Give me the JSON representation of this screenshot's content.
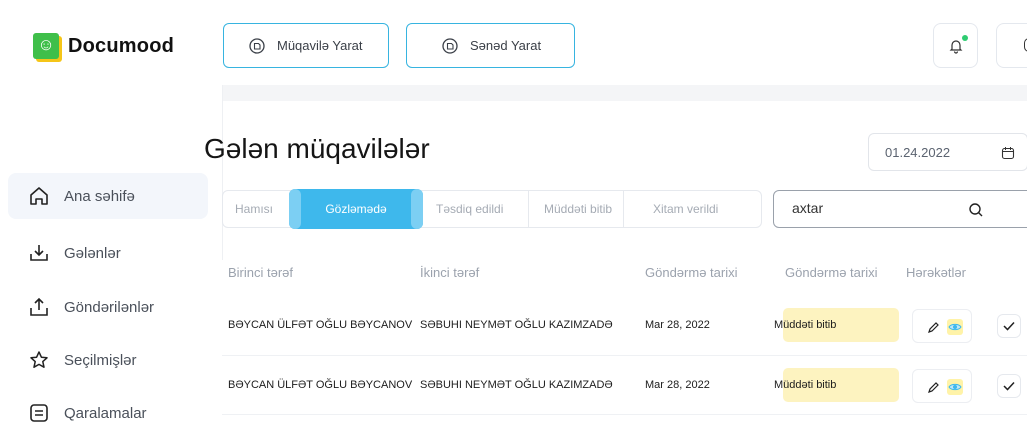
{
  "app": {
    "logo_text": "Documood",
    "logo_glyph": "☺"
  },
  "toolbar": {
    "create_contract": "Müqavilə Yarat",
    "create_document": "Sənəd Yarat"
  },
  "page": {
    "title": "Gələn müqavilələr",
    "date": "01.24.2022"
  },
  "sidebar": {
    "items": [
      {
        "label": "Ana səhifə",
        "icon": "home-icon"
      },
      {
        "label": "Gələnlər",
        "icon": "inbox-download-icon"
      },
      {
        "label": "Göndərilənlər",
        "icon": "upload-icon"
      },
      {
        "label": "Seçilmişlər",
        "icon": "star-icon"
      },
      {
        "label": "Qaralamalar",
        "icon": "drafts-icon"
      }
    ]
  },
  "tabs": [
    {
      "label": "Hamısı"
    },
    {
      "label": "Gözləmədə"
    },
    {
      "label": "Təsdiq edildi"
    },
    {
      "label": "Müddəti bitib"
    },
    {
      "label": "Xitam verildi"
    }
  ],
  "search": {
    "placeholder": "axtar"
  },
  "table": {
    "headers": [
      "Birinci tərəf",
      "İkinci tərəf",
      "Göndərmə tarixi",
      "Göndərmə tarixi",
      "Hərəkətlər"
    ],
    "rows": [
      {
        "first": "BƏYCAN ÜLFƏT OĞLU BƏYCANOV",
        "second": "SƏBUHI NEYMƏT OĞLU KAZIMZADƏ",
        "date": "Mar 28, 2022",
        "status": "Müddəti bitib"
      },
      {
        "first": "BƏYCAN ÜLFƏT OĞLU BƏYCANOV",
        "second": "SƏBUHI NEYMƏT OĞLU KAZIMZADƏ",
        "date": "Mar 28, 2022",
        "status": "Müddəti bitib"
      }
    ]
  },
  "colors": {
    "accent": "#3eb8ec",
    "status_bg": "#fdf3c0",
    "notification_dot": "#2ecc71",
    "logo_green": "#3fbf4a"
  }
}
